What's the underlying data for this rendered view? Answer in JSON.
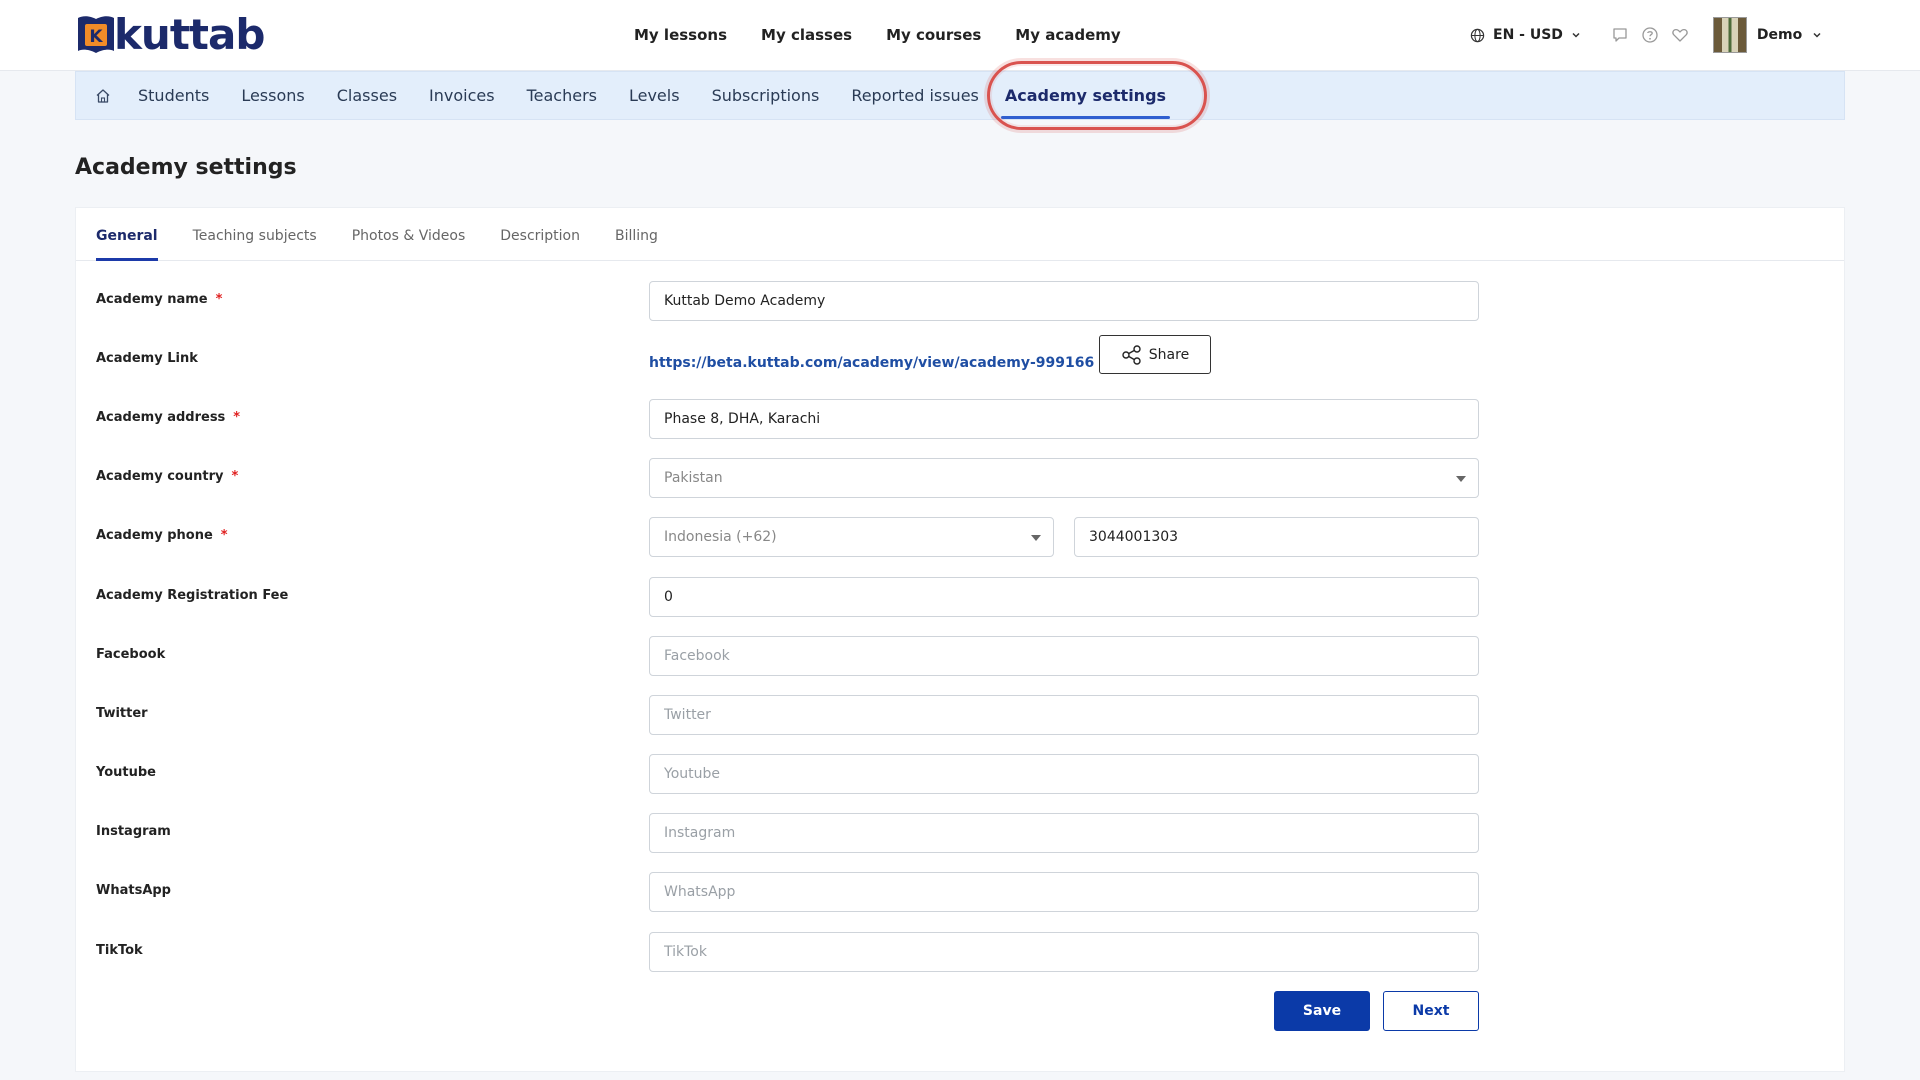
{
  "brand": {
    "name": "kuttab"
  },
  "main_nav": [
    "My lessons",
    "My classes",
    "My courses",
    "My academy"
  ],
  "header": {
    "locale": "EN - USD",
    "user_name": "Demo"
  },
  "subnav": {
    "items": [
      "Students",
      "Lessons",
      "Classes",
      "Invoices",
      "Teachers",
      "Levels",
      "Subscriptions",
      "Reported issues"
    ],
    "active": "Academy settings"
  },
  "page": {
    "title": "Academy settings"
  },
  "tabs": [
    "General",
    "Teaching subjects",
    "Photos & Videos",
    "Description",
    "Billing"
  ],
  "form": {
    "academy_name": {
      "label": "Academy name",
      "value": "Kuttab Demo Academy"
    },
    "academy_link": {
      "label": "Academy Link",
      "url": "https://beta.kuttab.com/academy/view/academy-999166",
      "share_label": "Share"
    },
    "academy_address": {
      "label": "Academy address",
      "value": "Phase 8, DHA, Karachi"
    },
    "academy_country": {
      "label": "Academy country",
      "value": "Pakistan"
    },
    "academy_phone": {
      "label": "Academy phone",
      "country_code": "Indonesia (+62)",
      "number": "3044001303"
    },
    "registration_fee": {
      "label": "Academy Registration Fee",
      "value": "0"
    },
    "facebook": {
      "label": "Facebook",
      "placeholder": "Facebook"
    },
    "twitter": {
      "label": "Twitter",
      "placeholder": "Twitter"
    },
    "youtube": {
      "label": "Youtube",
      "placeholder": "Youtube"
    },
    "instagram": {
      "label": "Instagram",
      "placeholder": "Instagram"
    },
    "whatsapp": {
      "label": "WhatsApp",
      "placeholder": "WhatsApp"
    },
    "tiktok": {
      "label": "TikTok",
      "placeholder": "TikTok"
    },
    "required_mark": "*"
  },
  "actions": {
    "save": "Save",
    "next": "Next"
  },
  "colors": {
    "primary": "#0b3aa8",
    "brand_navy": "#1c2a6b",
    "subnav_bg": "#e3eefb",
    "highlight": "#d9534f",
    "required": "#e02020"
  },
  "icons": [
    "logo-book-icon",
    "globe-icon",
    "chevron-down-icon",
    "chat-icon",
    "help-icon",
    "heart-icon",
    "home-icon",
    "share-icon",
    "caret-down-icon"
  ]
}
